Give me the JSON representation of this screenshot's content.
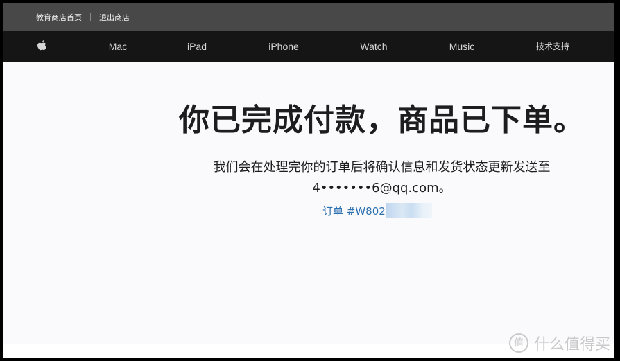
{
  "topbar": {
    "links": [
      "教育商店首页",
      "退出商店"
    ]
  },
  "nav": {
    "logo": "apple-logo-icon",
    "items": [
      "Mac",
      "iPad",
      "iPhone",
      "Watch",
      "Music",
      "技术支持"
    ]
  },
  "main": {
    "headline": "你已完成付款，商品已下单。",
    "message_line1": "我们会在处理完你的订单后将确认信息和发货状态更新发送至",
    "message_line2": "4•••••••6@qq.com。",
    "order_label": "订单 #W802",
    "order_link_color": "#2a6fb0"
  },
  "watermark": {
    "badge": "值",
    "text": "什么值得买"
  }
}
